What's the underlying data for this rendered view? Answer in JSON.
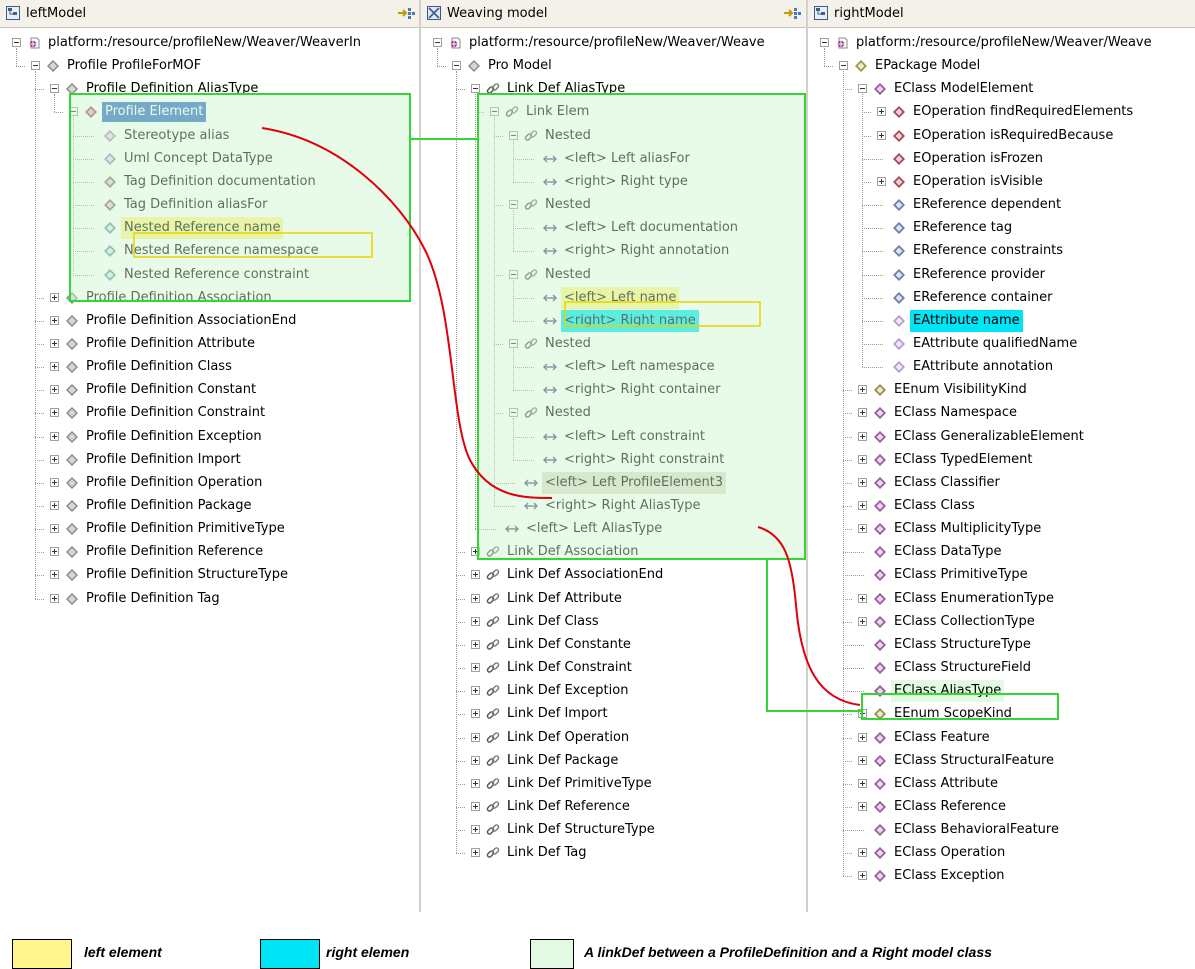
{
  "colors": {
    "left_highlight": "#fff58c",
    "right_highlight": "#00e5f5",
    "link_box_border": "#34d634",
    "link_box_fill": "#ccf7cc",
    "connector": "#e0000c",
    "selection": "#316ac5"
  },
  "panels": [
    {
      "title": "leftModel",
      "header_icon": "model-view-icon",
      "toolbar_icon": "collapse-all-icon",
      "rows": [
        {
          "level": 0,
          "exp": "minus",
          "icon": "resource-icon",
          "label": "platform:/resource/profileNew/Weaver/WeaverIn"
        },
        {
          "level": 1,
          "exp": "minus",
          "icon": "profile-icon",
          "label": "Profile ProfileForMOF"
        },
        {
          "level": 2,
          "exp": "minus",
          "icon": "profile-icon",
          "label": "Profile Definition AliasType"
        },
        {
          "level": 3,
          "exp": "minus",
          "icon": "element-icon",
          "label": "Profile Element",
          "hl": "sel"
        },
        {
          "level": 4,
          "icon": "stereotype-icon",
          "label": "Stereotype alias"
        },
        {
          "level": 4,
          "icon": "concept-icon",
          "label": "Uml Concept DataType"
        },
        {
          "level": 4,
          "icon": "tag-icon",
          "label": "Tag Definition documentation"
        },
        {
          "level": 4,
          "icon": "tag-icon",
          "label": "Tag Definition aliasFor"
        },
        {
          "level": 4,
          "icon": "nested-ref-icon",
          "label": "Nested Reference name",
          "hl": "y"
        },
        {
          "level": 4,
          "icon": "nested-ref-icon",
          "label": "Nested Reference namespace"
        },
        {
          "level": 4,
          "icon": "nested-ref-icon",
          "label": "Nested Reference constraint"
        },
        {
          "level": 2,
          "exp": "plus",
          "icon": "profile-icon",
          "label": "Profile Definition Association"
        },
        {
          "level": 2,
          "exp": "plus",
          "icon": "profile-icon",
          "label": "Profile Definition AssociationEnd"
        },
        {
          "level": 2,
          "exp": "plus",
          "icon": "profile-icon",
          "label": "Profile Definition Attribute"
        },
        {
          "level": 2,
          "exp": "plus",
          "icon": "profile-icon",
          "label": "Profile Definition Class"
        },
        {
          "level": 2,
          "exp": "plus",
          "icon": "profile-icon",
          "label": "Profile Definition Constant"
        },
        {
          "level": 2,
          "exp": "plus",
          "icon": "profile-icon",
          "label": "Profile Definition Constraint"
        },
        {
          "level": 2,
          "exp": "plus",
          "icon": "profile-icon",
          "label": "Profile Definition Exception"
        },
        {
          "level": 2,
          "exp": "plus",
          "icon": "profile-icon",
          "label": "Profile Definition Import"
        },
        {
          "level": 2,
          "exp": "plus",
          "icon": "profile-icon",
          "label": "Profile Definition Operation"
        },
        {
          "level": 2,
          "exp": "plus",
          "icon": "profile-icon",
          "label": "Profile Definition Package"
        },
        {
          "level": 2,
          "exp": "plus",
          "icon": "profile-icon",
          "label": "Profile Definition PrimitiveType"
        },
        {
          "level": 2,
          "exp": "plus",
          "icon": "profile-icon",
          "label": "Profile Definition Reference"
        },
        {
          "level": 2,
          "exp": "plus",
          "icon": "profile-icon",
          "label": "Profile Definition StructureType"
        },
        {
          "level": 2,
          "exp": "plus",
          "icon": "profile-icon",
          "label": "Profile Definition Tag"
        }
      ]
    },
    {
      "title": "Weaving model",
      "header_icon": "weaving-model-icon",
      "toolbar_icon": "collapse-all-icon",
      "rows": [
        {
          "level": 0,
          "exp": "minus",
          "icon": "resource-icon",
          "label": "platform:/resource/profileNew/Weaver/Weave"
        },
        {
          "level": 1,
          "exp": "minus",
          "icon": "profile-icon",
          "label": "Pro Model"
        },
        {
          "level": 2,
          "exp": "minus",
          "icon": "link-icon",
          "label": "Link Def AliasType"
        },
        {
          "level": 3,
          "exp": "minus",
          "icon": "link-icon",
          "label": "Link Elem"
        },
        {
          "level": 4,
          "exp": "minus",
          "icon": "link-icon",
          "label": "Nested"
        },
        {
          "level": 5,
          "icon": "endpoint-icon",
          "label": "<left> Left aliasFor"
        },
        {
          "level": 5,
          "icon": "endpoint-icon",
          "label": "<right> Right type"
        },
        {
          "level": 4,
          "exp": "minus",
          "icon": "link-icon",
          "label": "Nested"
        },
        {
          "level": 5,
          "icon": "endpoint-icon",
          "label": "<left> Left documentation"
        },
        {
          "level": 5,
          "icon": "endpoint-icon",
          "label": "<right> Right annotation"
        },
        {
          "level": 4,
          "exp": "minus",
          "icon": "link-icon",
          "label": "Nested"
        },
        {
          "level": 5,
          "icon": "endpoint-icon",
          "label": "<left> Left name",
          "hl": "y"
        },
        {
          "level": 5,
          "icon": "endpoint-icon",
          "label": "<right> Right name",
          "hl": "c"
        },
        {
          "level": 4,
          "exp": "minus",
          "icon": "link-icon",
          "label": "Nested"
        },
        {
          "level": 5,
          "icon": "endpoint-icon",
          "label": "<left> Left namespace"
        },
        {
          "level": 5,
          "icon": "endpoint-icon",
          "label": "<right> Right container"
        },
        {
          "level": 4,
          "exp": "minus",
          "icon": "link-icon",
          "label": "Nested"
        },
        {
          "level": 5,
          "icon": "endpoint-icon",
          "label": "<left> Left constraint"
        },
        {
          "level": 5,
          "icon": "endpoint-icon",
          "label": "<right> Right constraint"
        },
        {
          "level": 4,
          "icon": "endpoint-icon",
          "label": "<left> Left ProfileElement3",
          "hl": "s"
        },
        {
          "level": 4,
          "icon": "endpoint-icon",
          "label": "<right> Right AliasType"
        },
        {
          "level": 3,
          "icon": "endpoint-icon",
          "label": "<left> Left AliasType"
        },
        {
          "level": 2,
          "exp": "plus",
          "icon": "link-icon",
          "label": "Link Def Association"
        },
        {
          "level": 2,
          "exp": "plus",
          "icon": "link-icon",
          "label": "Link Def AssociationEnd"
        },
        {
          "level": 2,
          "exp": "plus",
          "icon": "link-icon",
          "label": "Link Def Attribute"
        },
        {
          "level": 2,
          "exp": "plus",
          "icon": "link-icon",
          "label": "Link Def Class"
        },
        {
          "level": 2,
          "exp": "plus",
          "icon": "link-icon",
          "label": "Link Def Constante"
        },
        {
          "level": 2,
          "exp": "plus",
          "icon": "link-icon",
          "label": "Link Def Constraint"
        },
        {
          "level": 2,
          "exp": "plus",
          "icon": "link-icon",
          "label": "Link Def Exception"
        },
        {
          "level": 2,
          "exp": "plus",
          "icon": "link-icon",
          "label": "Link Def Import"
        },
        {
          "level": 2,
          "exp": "plus",
          "icon": "link-icon",
          "label": "Link Def Operation"
        },
        {
          "level": 2,
          "exp": "plus",
          "icon": "link-icon",
          "label": "Link Def Package"
        },
        {
          "level": 2,
          "exp": "plus",
          "icon": "link-icon",
          "label": "Link Def PrimitiveType"
        },
        {
          "level": 2,
          "exp": "plus",
          "icon": "link-icon",
          "label": "Link Def Reference"
        },
        {
          "level": 2,
          "exp": "plus",
          "icon": "link-icon",
          "label": "Link Def StructureType"
        },
        {
          "level": 2,
          "exp": "plus",
          "icon": "link-icon",
          "label": "Link Def Tag"
        }
      ]
    },
    {
      "title": "rightModel",
      "header_icon": "model-view-icon",
      "toolbar_icon": "",
      "rows": [
        {
          "level": 0,
          "exp": "minus",
          "icon": "resource-icon",
          "label": "platform:/resource/profileNew/Weaver/Weave"
        },
        {
          "level": 1,
          "exp": "minus",
          "icon": "epackage-icon",
          "label": "EPackage Model"
        },
        {
          "level": 2,
          "exp": "minus",
          "icon": "eclass-icon",
          "label": "EClass ModelElement"
        },
        {
          "level": 3,
          "exp": "plus",
          "icon": "eoperation-icon",
          "label": "EOperation findRequiredElements"
        },
        {
          "level": 3,
          "exp": "plus",
          "icon": "eoperation-icon",
          "label": "EOperation isRequiredBecause"
        },
        {
          "level": 3,
          "icon": "eoperation-icon",
          "label": "EOperation isFrozen"
        },
        {
          "level": 3,
          "exp": "plus",
          "icon": "eoperation-icon",
          "label": "EOperation isVisible"
        },
        {
          "level": 3,
          "icon": "ereference-icon",
          "label": "EReference dependent"
        },
        {
          "level": 3,
          "icon": "ereference-icon",
          "label": "EReference tag"
        },
        {
          "level": 3,
          "icon": "ereference-icon",
          "label": "EReference constraints"
        },
        {
          "level": 3,
          "icon": "ereference-icon",
          "label": "EReference provider"
        },
        {
          "level": 3,
          "icon": "ereference-icon",
          "label": "EReference container"
        },
        {
          "level": 3,
          "icon": "eattribute-icon",
          "label": "EAttribute name",
          "hl": "c"
        },
        {
          "level": 3,
          "icon": "eattribute-icon",
          "label": "EAttribute qualifiedName"
        },
        {
          "level": 3,
          "icon": "eattribute-icon",
          "label": "EAttribute annotation"
        },
        {
          "level": 2,
          "exp": "plus",
          "icon": "eenum-icon",
          "label": "EEnum VisibilityKind"
        },
        {
          "level": 2,
          "exp": "plus",
          "icon": "eclass-icon",
          "label": "EClass Namespace"
        },
        {
          "level": 2,
          "exp": "plus",
          "icon": "eclass-icon",
          "label": "EClass GeneralizableElement"
        },
        {
          "level": 2,
          "exp": "plus",
          "icon": "eclass-icon",
          "label": "EClass TypedElement"
        },
        {
          "level": 2,
          "exp": "plus",
          "icon": "eclass-icon",
          "label": "EClass Classifier"
        },
        {
          "level": 2,
          "exp": "plus",
          "icon": "eclass-icon",
          "label": "EClass Class"
        },
        {
          "level": 2,
          "exp": "plus",
          "icon": "eclass-icon",
          "label": "EClass MultiplicityType"
        },
        {
          "level": 2,
          "icon": "eclass-icon",
          "label": "EClass DataType"
        },
        {
          "level": 2,
          "icon": "eclass-icon",
          "label": "EClass PrimitiveType"
        },
        {
          "level": 2,
          "exp": "plus",
          "icon": "eclass-icon",
          "label": "EClass EnumerationType"
        },
        {
          "level": 2,
          "exp": "plus",
          "icon": "eclass-icon",
          "label": "EClass CollectionType"
        },
        {
          "level": 2,
          "icon": "eclass-icon",
          "label": "EClass StructureType"
        },
        {
          "level": 2,
          "icon": "eclass-icon",
          "label": "EClass StructureField"
        },
        {
          "level": 2,
          "icon": "eclass-icon",
          "label": "EClass AliasType",
          "hl": "g"
        },
        {
          "level": 2,
          "exp": "plus",
          "icon": "eenum-icon",
          "label": "EEnum ScopeKind"
        },
        {
          "level": 2,
          "exp": "plus",
          "icon": "eclass-icon",
          "label": "EClass Feature"
        },
        {
          "level": 2,
          "exp": "plus",
          "icon": "eclass-icon",
          "label": "EClass StructuralFeature"
        },
        {
          "level": 2,
          "exp": "plus",
          "icon": "eclass-icon",
          "label": "EClass Attribute"
        },
        {
          "level": 2,
          "exp": "plus",
          "icon": "eclass-icon",
          "label": "EClass Reference"
        },
        {
          "level": 2,
          "icon": "eclass-icon",
          "label": "EClass BehavioralFeature"
        },
        {
          "level": 2,
          "exp": "plus",
          "icon": "eclass-icon",
          "label": "EClass Operation"
        },
        {
          "level": 2,
          "exp": "plus",
          "icon": "eclass-icon",
          "label": "EClass Exception"
        }
      ]
    }
  ],
  "legend": {
    "left_element": "left element",
    "right_element": "right elemen",
    "link_def": "A linkDef between a ProfileDefinition and a Right model class"
  }
}
